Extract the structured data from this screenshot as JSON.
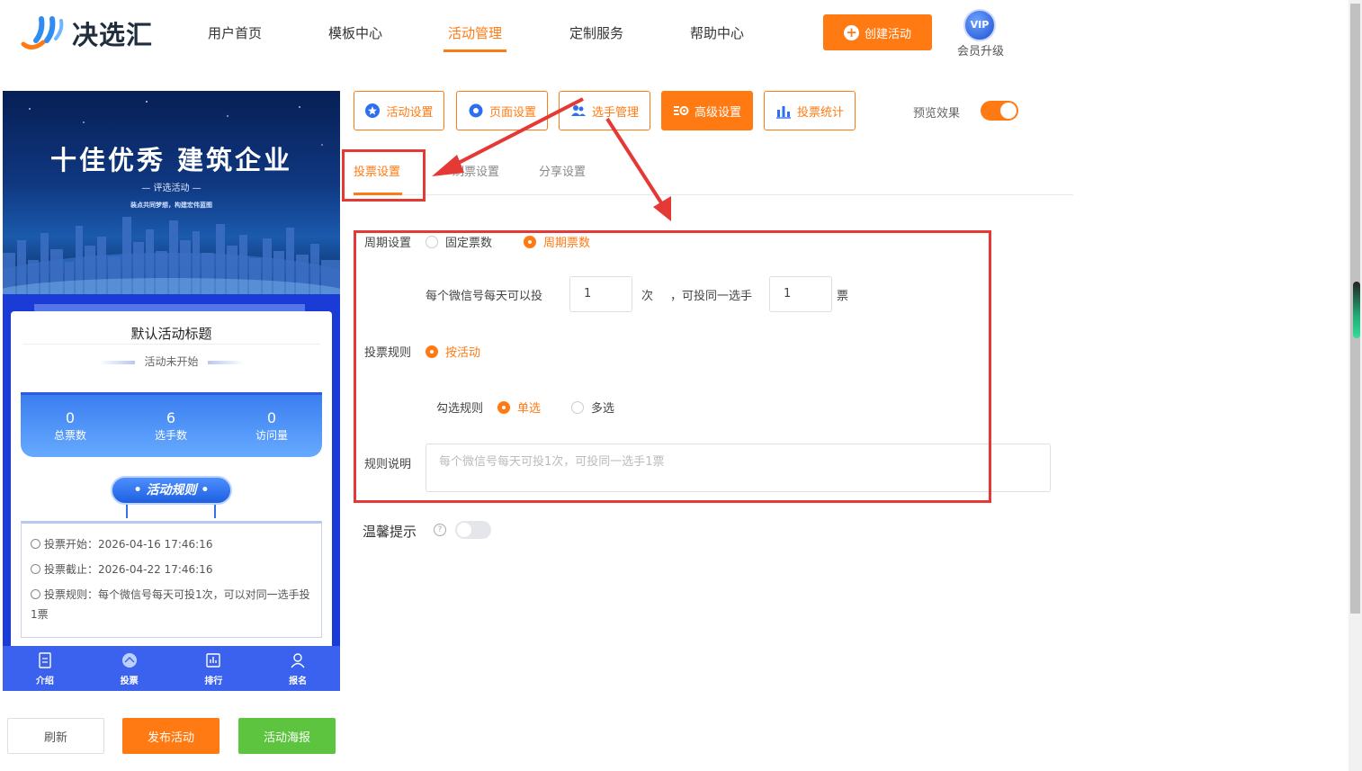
{
  "header": {
    "logo_text": "决选汇",
    "nav": [
      "用户首页",
      "模板中心",
      "活动管理",
      "定制服务",
      "帮助中心"
    ],
    "active_nav": "活动管理",
    "create_button": "创建活动",
    "vip_badge": "VIP",
    "vip_label": "会员升级"
  },
  "phone": {
    "banner_title": "十佳优秀 建筑企业",
    "banner_sub": "— 评选活动 —",
    "banner_slogan": "装点共同梦想，构建宏伟蓝图",
    "card_title": "默认活动标题",
    "card_status": "活动未开始",
    "stats": [
      {
        "value": "0",
        "label": "总票数"
      },
      {
        "value": "6",
        "label": "选手数"
      },
      {
        "value": "0",
        "label": "访问量"
      }
    ],
    "rules_button": "• 活动规则 •",
    "rules": {
      "start": "投票开始：2026-04-16 17:46:16",
      "end": "投票截止：2026-04-22 17:46:16",
      "rule": "投票规则：每个微信号每天可投1次，可以对同一选手投1票"
    },
    "tabbar": [
      "介绍",
      "投票",
      "排行",
      "报名"
    ]
  },
  "bottom_buttons": {
    "refresh": "刷新",
    "publish": "发布活动",
    "poster": "活动海报"
  },
  "toolbar": {
    "activity_settings": "活动设置",
    "page_settings": "页面设置",
    "player_management": "选手管理",
    "advanced_settings": "高级设置",
    "vote_stats": "投票统计",
    "preview_label": "预览效果"
  },
  "subtabs": [
    "投票设置",
    "刷票设置",
    "分享设置"
  ],
  "form": {
    "cycle_label": "周期设置",
    "cycle_options": [
      "固定票数",
      "周期票数"
    ],
    "daily_prefix": "每个微信号每天可以投",
    "daily_value": "1",
    "times_unit": "次",
    "same_player_text": "，可投同一选手",
    "same_value": "1",
    "votes_unit": "票",
    "vote_rule_label": "投票规则",
    "vote_rule_option": "按活动",
    "check_rule_label": "勾选规则",
    "check_options": [
      "单选",
      "多选"
    ],
    "rule_desc_label": "规则说明",
    "rule_desc_placeholder": "每个微信号每天可投1次，可投同一选手1票",
    "tip_label": "温馨提示",
    "help_mark": "?"
  },
  "colors": {
    "accent": "#ff7a12",
    "annotation_red": "#e53935",
    "phone_blue": "#1a3bd6",
    "green": "#5cc43e"
  }
}
